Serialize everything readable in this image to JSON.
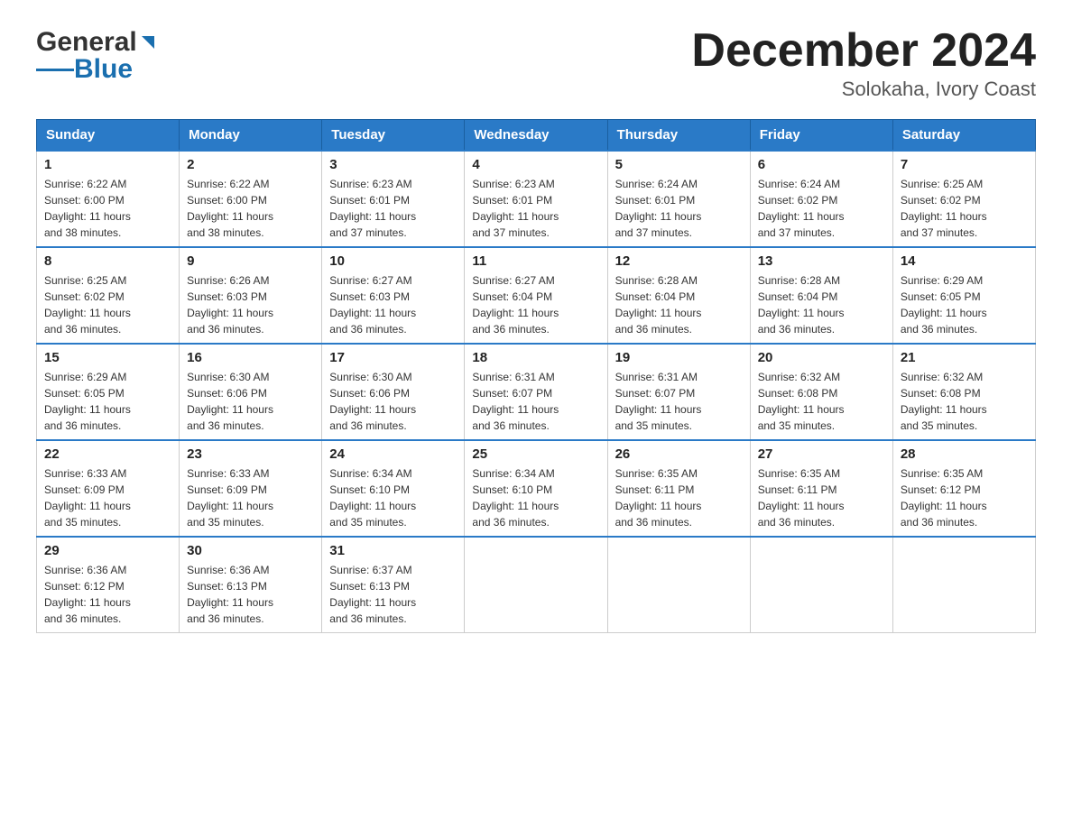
{
  "header": {
    "logo_general": "General",
    "logo_blue": "Blue",
    "month": "December 2024",
    "location": "Solokaha, Ivory Coast"
  },
  "weekdays": [
    "Sunday",
    "Monday",
    "Tuesday",
    "Wednesday",
    "Thursday",
    "Friday",
    "Saturday"
  ],
  "weeks": [
    [
      {
        "day": "1",
        "sunrise": "6:22 AM",
        "sunset": "6:00 PM",
        "daylight": "11 hours and 38 minutes."
      },
      {
        "day": "2",
        "sunrise": "6:22 AM",
        "sunset": "6:00 PM",
        "daylight": "11 hours and 38 minutes."
      },
      {
        "day": "3",
        "sunrise": "6:23 AM",
        "sunset": "6:01 PM",
        "daylight": "11 hours and 37 minutes."
      },
      {
        "day": "4",
        "sunrise": "6:23 AM",
        "sunset": "6:01 PM",
        "daylight": "11 hours and 37 minutes."
      },
      {
        "day": "5",
        "sunrise": "6:24 AM",
        "sunset": "6:01 PM",
        "daylight": "11 hours and 37 minutes."
      },
      {
        "day": "6",
        "sunrise": "6:24 AM",
        "sunset": "6:02 PM",
        "daylight": "11 hours and 37 minutes."
      },
      {
        "day": "7",
        "sunrise": "6:25 AM",
        "sunset": "6:02 PM",
        "daylight": "11 hours and 37 minutes."
      }
    ],
    [
      {
        "day": "8",
        "sunrise": "6:25 AM",
        "sunset": "6:02 PM",
        "daylight": "11 hours and 36 minutes."
      },
      {
        "day": "9",
        "sunrise": "6:26 AM",
        "sunset": "6:03 PM",
        "daylight": "11 hours and 36 minutes."
      },
      {
        "day": "10",
        "sunrise": "6:27 AM",
        "sunset": "6:03 PM",
        "daylight": "11 hours and 36 minutes."
      },
      {
        "day": "11",
        "sunrise": "6:27 AM",
        "sunset": "6:04 PM",
        "daylight": "11 hours and 36 minutes."
      },
      {
        "day": "12",
        "sunrise": "6:28 AM",
        "sunset": "6:04 PM",
        "daylight": "11 hours and 36 minutes."
      },
      {
        "day": "13",
        "sunrise": "6:28 AM",
        "sunset": "6:04 PM",
        "daylight": "11 hours and 36 minutes."
      },
      {
        "day": "14",
        "sunrise": "6:29 AM",
        "sunset": "6:05 PM",
        "daylight": "11 hours and 36 minutes."
      }
    ],
    [
      {
        "day": "15",
        "sunrise": "6:29 AM",
        "sunset": "6:05 PM",
        "daylight": "11 hours and 36 minutes."
      },
      {
        "day": "16",
        "sunrise": "6:30 AM",
        "sunset": "6:06 PM",
        "daylight": "11 hours and 36 minutes."
      },
      {
        "day": "17",
        "sunrise": "6:30 AM",
        "sunset": "6:06 PM",
        "daylight": "11 hours and 36 minutes."
      },
      {
        "day": "18",
        "sunrise": "6:31 AM",
        "sunset": "6:07 PM",
        "daylight": "11 hours and 36 minutes."
      },
      {
        "day": "19",
        "sunrise": "6:31 AM",
        "sunset": "6:07 PM",
        "daylight": "11 hours and 35 minutes."
      },
      {
        "day": "20",
        "sunrise": "6:32 AM",
        "sunset": "6:08 PM",
        "daylight": "11 hours and 35 minutes."
      },
      {
        "day": "21",
        "sunrise": "6:32 AM",
        "sunset": "6:08 PM",
        "daylight": "11 hours and 35 minutes."
      }
    ],
    [
      {
        "day": "22",
        "sunrise": "6:33 AM",
        "sunset": "6:09 PM",
        "daylight": "11 hours and 35 minutes."
      },
      {
        "day": "23",
        "sunrise": "6:33 AM",
        "sunset": "6:09 PM",
        "daylight": "11 hours and 35 minutes."
      },
      {
        "day": "24",
        "sunrise": "6:34 AM",
        "sunset": "6:10 PM",
        "daylight": "11 hours and 35 minutes."
      },
      {
        "day": "25",
        "sunrise": "6:34 AM",
        "sunset": "6:10 PM",
        "daylight": "11 hours and 36 minutes."
      },
      {
        "day": "26",
        "sunrise": "6:35 AM",
        "sunset": "6:11 PM",
        "daylight": "11 hours and 36 minutes."
      },
      {
        "day": "27",
        "sunrise": "6:35 AM",
        "sunset": "6:11 PM",
        "daylight": "11 hours and 36 minutes."
      },
      {
        "day": "28",
        "sunrise": "6:35 AM",
        "sunset": "6:12 PM",
        "daylight": "11 hours and 36 minutes."
      }
    ],
    [
      {
        "day": "29",
        "sunrise": "6:36 AM",
        "sunset": "6:12 PM",
        "daylight": "11 hours and 36 minutes."
      },
      {
        "day": "30",
        "sunrise": "6:36 AM",
        "sunset": "6:13 PM",
        "daylight": "11 hours and 36 minutes."
      },
      {
        "day": "31",
        "sunrise": "6:37 AM",
        "sunset": "6:13 PM",
        "daylight": "11 hours and 36 minutes."
      },
      null,
      null,
      null,
      null
    ]
  ],
  "labels": {
    "sunrise": "Sunrise:",
    "sunset": "Sunset:",
    "daylight": "Daylight:"
  }
}
